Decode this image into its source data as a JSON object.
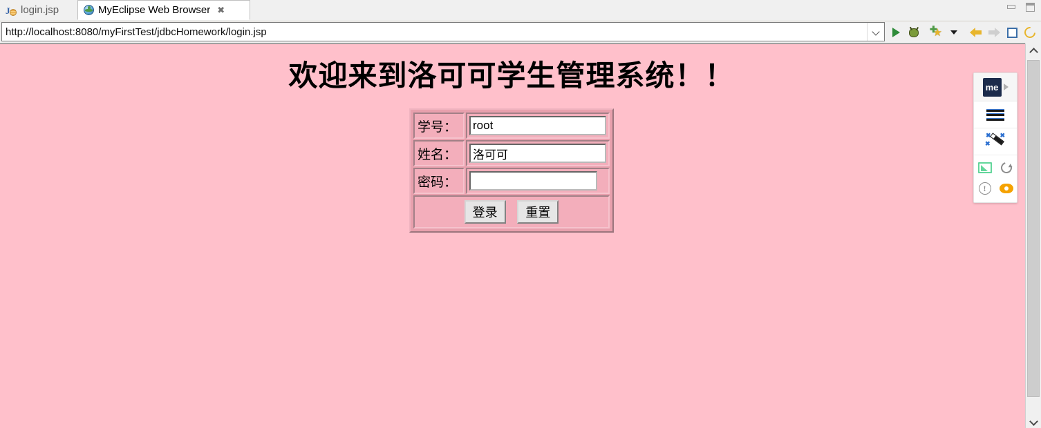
{
  "window": {
    "minimize_icon": "minimize-icon",
    "maximize_icon": "maximize-icon"
  },
  "tabs": [
    {
      "label": "login.jsp",
      "icon": "jsp-file-icon",
      "active": false
    },
    {
      "label": "MyEclipse Web Browser",
      "icon": "globe-icon",
      "active": true,
      "close_icon": "close-icon"
    }
  ],
  "address_bar": {
    "url": "http://localhost:8080/myFirstTest/jdbcHomework/login.jsp",
    "dropdown_icon": "chevron-down-icon"
  },
  "toolbar": {
    "buttons": [
      {
        "name": "run-button",
        "icon": "run-icon"
      },
      {
        "name": "debug-button",
        "icon": "debug-bug-icon"
      },
      {
        "name": "add-bookmark-button",
        "icon": "star-plus-icon"
      },
      {
        "name": "bookmark-dropdown-button",
        "icon": "caret-down-icon"
      },
      {
        "name": "back-button",
        "icon": "arrow-left-icon"
      },
      {
        "name": "forward-button",
        "icon": "arrow-right-icon"
      },
      {
        "name": "stop-button",
        "icon": "stop-square-icon"
      },
      {
        "name": "refresh-button",
        "icon": "refresh-icon"
      },
      {
        "name": "link-button",
        "icon": "chain-link-icon"
      }
    ]
  },
  "page": {
    "background_color": "#FFC0CB",
    "heading": "欢迎来到洛可可学生管理系统！！",
    "form": {
      "rows": [
        {
          "label": "学号：",
          "field_name": "student-id-input",
          "type": "text",
          "value": "root"
        },
        {
          "label": "姓名：",
          "field_name": "student-name-input",
          "type": "text",
          "value": "洛可可"
        },
        {
          "label": "密码：",
          "field_name": "password-input",
          "type": "password",
          "value": ""
        }
      ],
      "submit_label": "登录",
      "reset_label": "重置",
      "border_color": "#e8a0ad",
      "cell_color": "#f3aebb"
    }
  },
  "widget_panel": {
    "logo_text": "me",
    "expand_icon": "play-triangle-icon",
    "menu_icon": "hamburger-menu-icon",
    "wand_icon": "magic-wand-icon",
    "cast_icon": "cast-screen-icon",
    "reload_icon": "reload-icon",
    "warning_icon": "warning-circle-icon",
    "eye_icon": "eye-icon",
    "warning_glyph": "!"
  },
  "scrollbar": {
    "up_icon": "chevron-up-icon",
    "down_icon": "chevron-down-icon"
  }
}
